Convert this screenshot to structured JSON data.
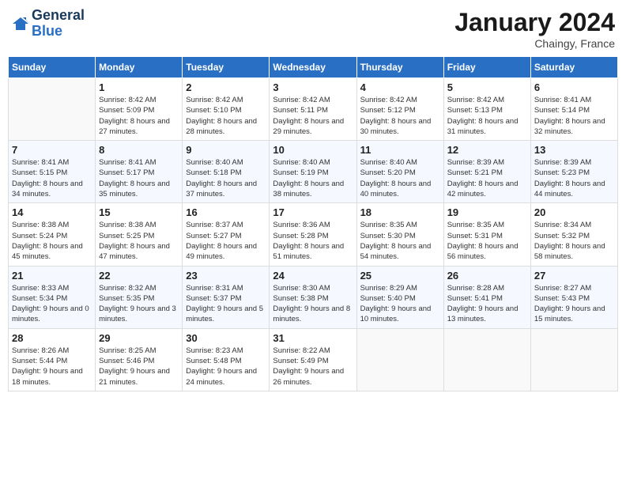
{
  "header": {
    "logo_line1": "General",
    "logo_line2": "Blue",
    "month_title": "January 2024",
    "location": "Chaingy, France"
  },
  "days_of_week": [
    "Sunday",
    "Monday",
    "Tuesday",
    "Wednesday",
    "Thursday",
    "Friday",
    "Saturday"
  ],
  "weeks": [
    [
      {
        "num": "",
        "empty": true
      },
      {
        "num": "1",
        "sunrise": "Sunrise: 8:42 AM",
        "sunset": "Sunset: 5:09 PM",
        "daylight": "Daylight: 8 hours and 27 minutes."
      },
      {
        "num": "2",
        "sunrise": "Sunrise: 8:42 AM",
        "sunset": "Sunset: 5:10 PM",
        "daylight": "Daylight: 8 hours and 28 minutes."
      },
      {
        "num": "3",
        "sunrise": "Sunrise: 8:42 AM",
        "sunset": "Sunset: 5:11 PM",
        "daylight": "Daylight: 8 hours and 29 minutes."
      },
      {
        "num": "4",
        "sunrise": "Sunrise: 8:42 AM",
        "sunset": "Sunset: 5:12 PM",
        "daylight": "Daylight: 8 hours and 30 minutes."
      },
      {
        "num": "5",
        "sunrise": "Sunrise: 8:42 AM",
        "sunset": "Sunset: 5:13 PM",
        "daylight": "Daylight: 8 hours and 31 minutes."
      },
      {
        "num": "6",
        "sunrise": "Sunrise: 8:41 AM",
        "sunset": "Sunset: 5:14 PM",
        "daylight": "Daylight: 8 hours and 32 minutes."
      }
    ],
    [
      {
        "num": "7",
        "sunrise": "Sunrise: 8:41 AM",
        "sunset": "Sunset: 5:15 PM",
        "daylight": "Daylight: 8 hours and 34 minutes."
      },
      {
        "num": "8",
        "sunrise": "Sunrise: 8:41 AM",
        "sunset": "Sunset: 5:17 PM",
        "daylight": "Daylight: 8 hours and 35 minutes."
      },
      {
        "num": "9",
        "sunrise": "Sunrise: 8:40 AM",
        "sunset": "Sunset: 5:18 PM",
        "daylight": "Daylight: 8 hours and 37 minutes."
      },
      {
        "num": "10",
        "sunrise": "Sunrise: 8:40 AM",
        "sunset": "Sunset: 5:19 PM",
        "daylight": "Daylight: 8 hours and 38 minutes."
      },
      {
        "num": "11",
        "sunrise": "Sunrise: 8:40 AM",
        "sunset": "Sunset: 5:20 PM",
        "daylight": "Daylight: 8 hours and 40 minutes."
      },
      {
        "num": "12",
        "sunrise": "Sunrise: 8:39 AM",
        "sunset": "Sunset: 5:21 PM",
        "daylight": "Daylight: 8 hours and 42 minutes."
      },
      {
        "num": "13",
        "sunrise": "Sunrise: 8:39 AM",
        "sunset": "Sunset: 5:23 PM",
        "daylight": "Daylight: 8 hours and 44 minutes."
      }
    ],
    [
      {
        "num": "14",
        "sunrise": "Sunrise: 8:38 AM",
        "sunset": "Sunset: 5:24 PM",
        "daylight": "Daylight: 8 hours and 45 minutes."
      },
      {
        "num": "15",
        "sunrise": "Sunrise: 8:38 AM",
        "sunset": "Sunset: 5:25 PM",
        "daylight": "Daylight: 8 hours and 47 minutes."
      },
      {
        "num": "16",
        "sunrise": "Sunrise: 8:37 AM",
        "sunset": "Sunset: 5:27 PM",
        "daylight": "Daylight: 8 hours and 49 minutes."
      },
      {
        "num": "17",
        "sunrise": "Sunrise: 8:36 AM",
        "sunset": "Sunset: 5:28 PM",
        "daylight": "Daylight: 8 hours and 51 minutes."
      },
      {
        "num": "18",
        "sunrise": "Sunrise: 8:35 AM",
        "sunset": "Sunset: 5:30 PM",
        "daylight": "Daylight: 8 hours and 54 minutes."
      },
      {
        "num": "19",
        "sunrise": "Sunrise: 8:35 AM",
        "sunset": "Sunset: 5:31 PM",
        "daylight": "Daylight: 8 hours and 56 minutes."
      },
      {
        "num": "20",
        "sunrise": "Sunrise: 8:34 AM",
        "sunset": "Sunset: 5:32 PM",
        "daylight": "Daylight: 8 hours and 58 minutes."
      }
    ],
    [
      {
        "num": "21",
        "sunrise": "Sunrise: 8:33 AM",
        "sunset": "Sunset: 5:34 PM",
        "daylight": "Daylight: 9 hours and 0 minutes."
      },
      {
        "num": "22",
        "sunrise": "Sunrise: 8:32 AM",
        "sunset": "Sunset: 5:35 PM",
        "daylight": "Daylight: 9 hours and 3 minutes."
      },
      {
        "num": "23",
        "sunrise": "Sunrise: 8:31 AM",
        "sunset": "Sunset: 5:37 PM",
        "daylight": "Daylight: 9 hours and 5 minutes."
      },
      {
        "num": "24",
        "sunrise": "Sunrise: 8:30 AM",
        "sunset": "Sunset: 5:38 PM",
        "daylight": "Daylight: 9 hours and 8 minutes."
      },
      {
        "num": "25",
        "sunrise": "Sunrise: 8:29 AM",
        "sunset": "Sunset: 5:40 PM",
        "daylight": "Daylight: 9 hours and 10 minutes."
      },
      {
        "num": "26",
        "sunrise": "Sunrise: 8:28 AM",
        "sunset": "Sunset: 5:41 PM",
        "daylight": "Daylight: 9 hours and 13 minutes."
      },
      {
        "num": "27",
        "sunrise": "Sunrise: 8:27 AM",
        "sunset": "Sunset: 5:43 PM",
        "daylight": "Daylight: 9 hours and 15 minutes."
      }
    ],
    [
      {
        "num": "28",
        "sunrise": "Sunrise: 8:26 AM",
        "sunset": "Sunset: 5:44 PM",
        "daylight": "Daylight: 9 hours and 18 minutes."
      },
      {
        "num": "29",
        "sunrise": "Sunrise: 8:25 AM",
        "sunset": "Sunset: 5:46 PM",
        "daylight": "Daylight: 9 hours and 21 minutes."
      },
      {
        "num": "30",
        "sunrise": "Sunrise: 8:23 AM",
        "sunset": "Sunset: 5:48 PM",
        "daylight": "Daylight: 9 hours and 24 minutes."
      },
      {
        "num": "31",
        "sunrise": "Sunrise: 8:22 AM",
        "sunset": "Sunset: 5:49 PM",
        "daylight": "Daylight: 9 hours and 26 minutes."
      },
      {
        "num": "",
        "empty": true
      },
      {
        "num": "",
        "empty": true
      },
      {
        "num": "",
        "empty": true
      }
    ]
  ]
}
